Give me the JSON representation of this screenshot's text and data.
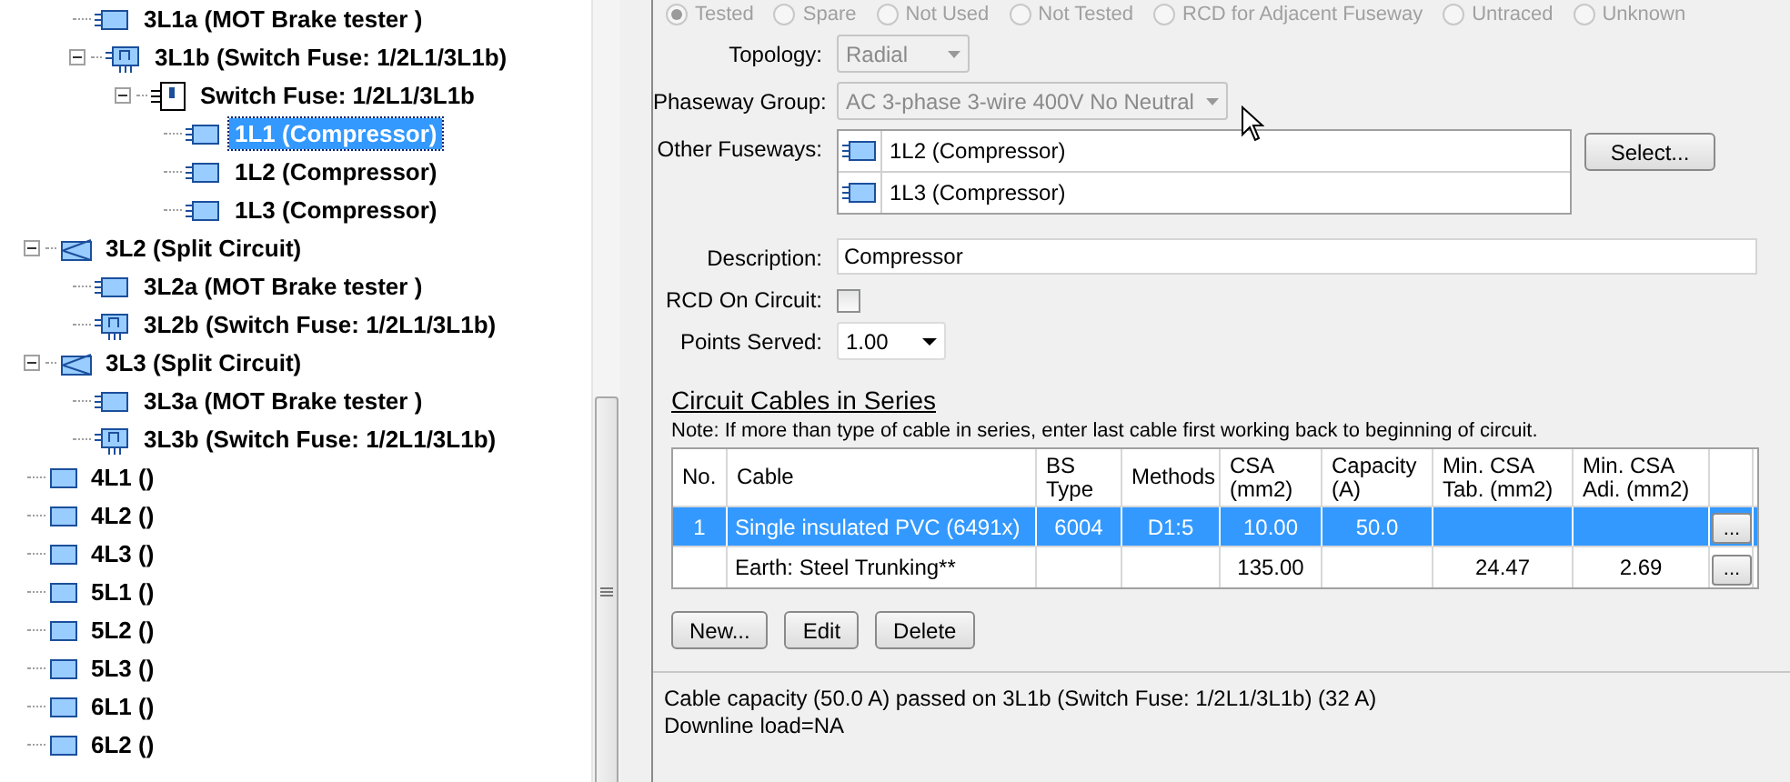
{
  "tree": {
    "continued_children": [
      {
        "label": "3L1a (MOT Brake tester )",
        "kind": "load",
        "selected": false
      },
      {
        "label": "3L1b (Switch Fuse: 1/2L1/3L1b)",
        "kind": "switch_way",
        "selected": false,
        "expanded": true,
        "children": [
          {
            "label": "Switch Fuse: 1/2L1/3L1b",
            "kind": "switch_fuse",
            "selected": false,
            "expanded": true,
            "children": [
              {
                "label": "1L1 (Compressor)",
                "kind": "load",
                "selected": true
              },
              {
                "label": "1L2 (Compressor)",
                "kind": "load",
                "selected": false
              },
              {
                "label": "1L3 (Compressor)",
                "kind": "load",
                "selected": false
              }
            ]
          }
        ]
      }
    ],
    "items": [
      {
        "label": "3L2 (Split Circuit)",
        "kind": "split",
        "selected": false,
        "expanded": true,
        "children": [
          {
            "label": "3L2a (MOT Brake tester )",
            "kind": "load",
            "selected": false
          },
          {
            "label": "3L2b (Switch Fuse: 1/2L1/3L1b)",
            "kind": "switch_way",
            "selected": false
          }
        ]
      },
      {
        "label": "3L3 (Split Circuit)",
        "kind": "split",
        "selected": false,
        "expanded": true,
        "children": [
          {
            "label": "3L3a (MOT Brake tester )",
            "kind": "load",
            "selected": false
          },
          {
            "label": "3L3b (Switch Fuse: 1/2L1/3L1b)",
            "kind": "switch_way",
            "selected": false
          }
        ]
      },
      {
        "label": "4L1 ()",
        "kind": "plain",
        "selected": false
      },
      {
        "label": "4L2 ()",
        "kind": "plain",
        "selected": false
      },
      {
        "label": "4L3 ()",
        "kind": "plain",
        "selected": false
      },
      {
        "label": "5L1 ()",
        "kind": "plain",
        "selected": false
      },
      {
        "label": "5L2 ()",
        "kind": "plain",
        "selected": false
      },
      {
        "label": "5L3 ()",
        "kind": "plain",
        "selected": false
      },
      {
        "label": "6L1 ()",
        "kind": "plain",
        "selected": false
      },
      {
        "label": "6L2 ()",
        "kind": "plain",
        "selected": false
      }
    ]
  },
  "status_options": {
    "disabled": true,
    "options": [
      {
        "label": "Tested",
        "selected": true
      },
      {
        "label": "Spare",
        "selected": false
      },
      {
        "label": "Not Used",
        "selected": false
      },
      {
        "label": "Not Tested",
        "selected": false
      },
      {
        "label": "RCD for Adjacent Fuseway",
        "selected": false
      },
      {
        "label": "Untraced",
        "selected": false
      },
      {
        "label": "Unknown",
        "selected": false
      }
    ]
  },
  "topology": {
    "label": "Topology:",
    "value": "Radial",
    "disabled": true
  },
  "phaseway_group": {
    "label": "Phaseway Group:",
    "value": "AC 3-phase 3-wire 400V No Neutral",
    "disabled": true
  },
  "other_fuseways": {
    "label": "Other Fuseways:",
    "items": [
      "1L2 (Compressor)",
      "1L3 (Compressor)"
    ],
    "button": "Select..."
  },
  "description": {
    "label": "Description:",
    "value": "Compressor"
  },
  "rcd_on_circuit": {
    "label": "RCD On Circuit:",
    "checked": false
  },
  "points_served": {
    "label": "Points Served:",
    "value": "1.00"
  },
  "cables": {
    "title": "Circuit Cables in Series",
    "note": "Note: If more than type of cable in series, enter last cable first working back to beginning of circuit.",
    "columns": [
      "No.",
      "Cable",
      "BS\nType",
      "Methods",
      "CSA\n(mm2)",
      "Capacity\n(A)",
      "Min. CSA\nTab. (mm2)",
      "Min. CSA\nAdi. (mm2)"
    ],
    "row_button": "...",
    "rows": [
      {
        "selected": true,
        "cells": [
          "1",
          "Single insulated PVC (6491x)",
          "6004",
          "D1:5",
          "10.00",
          "50.0",
          "",
          ""
        ]
      },
      {
        "selected": false,
        "cells": [
          "",
          "Earth: Steel Trunking**",
          "",
          "",
          "135.00",
          "",
          "24.47",
          "2.69"
        ]
      }
    ],
    "buttons": [
      "New...",
      "Edit",
      "Delete"
    ]
  },
  "status_bar": {
    "lines": [
      "Cable capacity (50.0 A) passed on 3L1b (Switch Fuse: 1/2L1/3L1b) (32 A)",
      "Downline load=NA"
    ]
  }
}
